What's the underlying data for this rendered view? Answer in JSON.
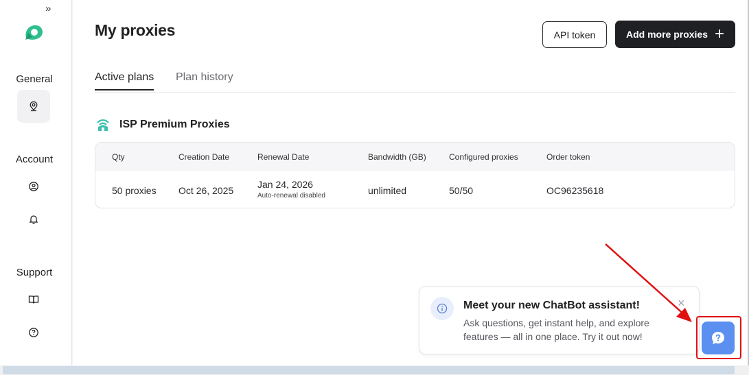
{
  "sidebar": {
    "expand_glyph": "»",
    "sections": [
      {
        "label": "General",
        "items": [
          {
            "icon": "location-pin-icon",
            "active": true
          }
        ]
      },
      {
        "label": "Account",
        "items": [
          {
            "icon": "user-circle-icon"
          },
          {
            "icon": "bell-icon"
          }
        ]
      },
      {
        "label": "Support",
        "items": [
          {
            "icon": "book-icon"
          },
          {
            "icon": "help-circle-icon"
          }
        ]
      }
    ]
  },
  "header": {
    "title": "My proxies",
    "api_token_label": "API token",
    "add_more_label": "Add more proxies",
    "add_icon": "+"
  },
  "tabs": [
    {
      "label": "Active plans",
      "active": true
    },
    {
      "label": "Plan history",
      "active": false
    }
  ],
  "plan": {
    "title": "ISP Premium Proxies",
    "icon": "isp-signal-icon",
    "columns": [
      "Qty",
      "Creation Date",
      "Renewal Date",
      "Bandwidth (GB)",
      "Configured proxies",
      "Order token"
    ],
    "rows": [
      {
        "qty": "50 proxies",
        "creation_date": "Oct 26, 2025",
        "renewal_date": "Jan 24, 2026",
        "renewal_note": "Auto-renewal disabled",
        "bandwidth": "unlimited",
        "configured": "50/50",
        "order_token": "OC96235618"
      }
    ]
  },
  "chatbot": {
    "title": "Meet your new ChatBot assistant!",
    "body": "Ask questions, get instant help, and explore features — all in one place. Try it out now!",
    "close_glyph": "×",
    "fab_icon": "chat-help-icon"
  },
  "colors": {
    "primary_dark": "#1f2024",
    "accent_blue": "#5b8ff0",
    "teal_brand": "#3dbfb0",
    "highlight_red": "#e01010"
  }
}
